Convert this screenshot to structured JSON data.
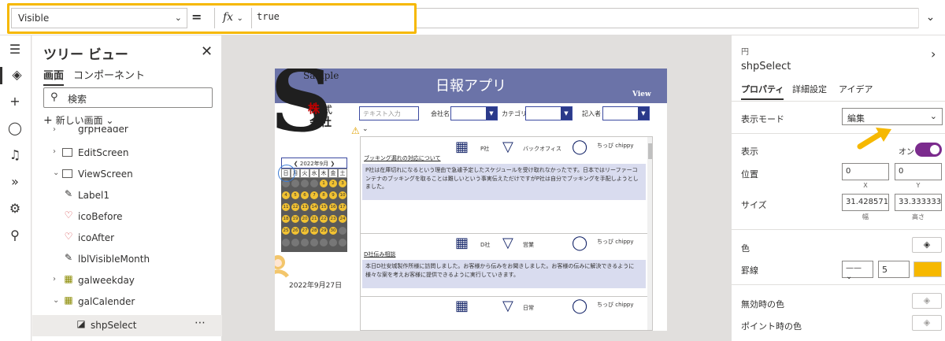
{
  "formula_bar": {
    "property": "Visible",
    "equals": "=",
    "fx": "fx",
    "formula": "true"
  },
  "rail": {
    "icons": [
      "hamburger-icon",
      "layers-icon",
      "plus-icon",
      "database-icon",
      "media-icon",
      "flow-icon",
      "tools-icon",
      "search-icon"
    ]
  },
  "tree": {
    "title": "ツリー ビュー",
    "tabs": [
      "画面",
      "コンポーネント"
    ],
    "search_placeholder": "検索",
    "new_screen": "新しい画面",
    "items": [
      {
        "label": "grpHeader"
      },
      {
        "label": "EditScreen"
      },
      {
        "label": "ViewScreen"
      },
      {
        "label": "Label1"
      },
      {
        "label": "icoBefore"
      },
      {
        "label": "icoAfter"
      },
      {
        "label": "lblVisibleMonth"
      },
      {
        "label": "galweekday"
      },
      {
        "label": "galCalender"
      },
      {
        "label": "shpSelect"
      }
    ]
  },
  "app": {
    "title": "日報アプリ",
    "view": "View",
    "logo_sample": "Sample",
    "logo_kabu": "株",
    "logo_shiki": "式",
    "logo_kaisha": "会社",
    "filter_placeholder": "テキスト入力",
    "filter_company": "会社名",
    "filter_category": "カテゴリ",
    "filter_writer": "記入者",
    "calendar_month": "2022年9月",
    "weekdays": [
      "日",
      "月",
      "火",
      "水",
      "木",
      "金",
      "土"
    ],
    "selected_date": "2022年9月27日",
    "cards": [
      {
        "title": "ブッキング漏れの対応について",
        "company": "P社",
        "category": "バックオフィス",
        "user": "ちっぴ chippy",
        "body": "P社は在庫切れになるという理由で急遽予定したスケジュールを受け取れなかったです。日本ではリーファーコンテナのブッキングを取ることは難しいという事実伝えただけですがP社は自分でブッキングを手配しようとしました。"
      },
      {
        "title": "D社伝み相談",
        "company": "D社",
        "category": "営業",
        "user": "ちっぴ chippy",
        "body": "本日D社安城製作所様に訪問しました。お客様から伝みをお聞きしました。お客様の伝みに解決できるように様々な案を考えお客様に提供できるように実行していきます。"
      },
      {
        "title": "",
        "company": "",
        "category": "日常",
        "user": "ちっぴ chippy",
        "body": ""
      }
    ]
  },
  "props": {
    "type": "円",
    "name": "shpSelect",
    "tabs": [
      "プロパティ",
      "詳細設定",
      "アイデア"
    ],
    "display_mode_label": "表示モード",
    "display_mode_value": "編集",
    "visible_label": "表示",
    "visible_value": "オン",
    "position_label": "位置",
    "x": "0",
    "y": "0",
    "x_sub": "X",
    "y_sub": "Y",
    "size_label": "サイズ",
    "width": "31.42857142",
    "height": "33.33333333",
    "width_sub": "幅",
    "height_sub": "高さ",
    "color_label": "色",
    "border_label": "罫線",
    "border_width": "5",
    "disabled_color_label": "無効時の色",
    "hover_color_label": "ポイント時の色",
    "accent_border": "#f6b800",
    "toggle_color": "#7b2b8d"
  }
}
